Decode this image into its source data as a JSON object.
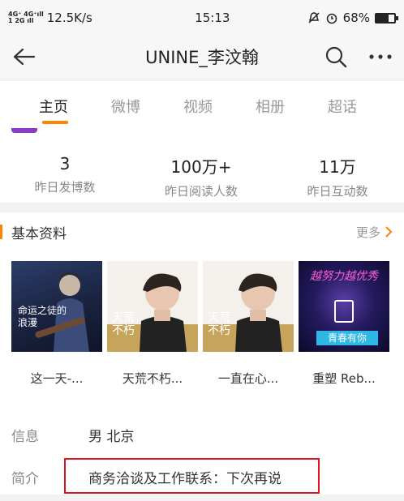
{
  "status_bar": {
    "network_top": "4G⁺ 4G⁺ıll",
    "network_bottom": "1  2G ıll",
    "speed": "12.5K/s",
    "time": "15:13",
    "battery": "68%",
    "battery_level": 0.68
  },
  "nav": {
    "title": "UNINE_李汶翰"
  },
  "tabs": [
    {
      "label": "主页",
      "active": true
    },
    {
      "label": "微博",
      "active": false
    },
    {
      "label": "视频",
      "active": false
    },
    {
      "label": "相册",
      "active": false
    },
    {
      "label": "超话",
      "active": false
    }
  ],
  "stats": [
    {
      "value": "3",
      "label": "昨日发博数"
    },
    {
      "value": "100万+",
      "label": "昨日阅读人数"
    },
    {
      "value": "11万",
      "label": "昨日互动数"
    }
  ],
  "profile": {
    "section_title": "基本资料",
    "more_label": "更多",
    "albums": [
      {
        "name": "这一天-...",
        "cover_text": "命运之徒的浪漫"
      },
      {
        "name": "天荒不朽...",
        "cover_text": "天荒不朽"
      },
      {
        "name": "一直在心...",
        "cover_text": "天荒不朽"
      },
      {
        "name": "重塑 Reb...",
        "cover_text": "越努力越优秀",
        "badge_text": "青春有你"
      }
    ],
    "info_label": "信息",
    "info_value": "男 北京",
    "intro_label": "简介",
    "intro_value": "商务洽谈及工作联系：下次再说"
  },
  "colors": {
    "accent": "#ff8200",
    "highlight_border": "#e0141e"
  }
}
